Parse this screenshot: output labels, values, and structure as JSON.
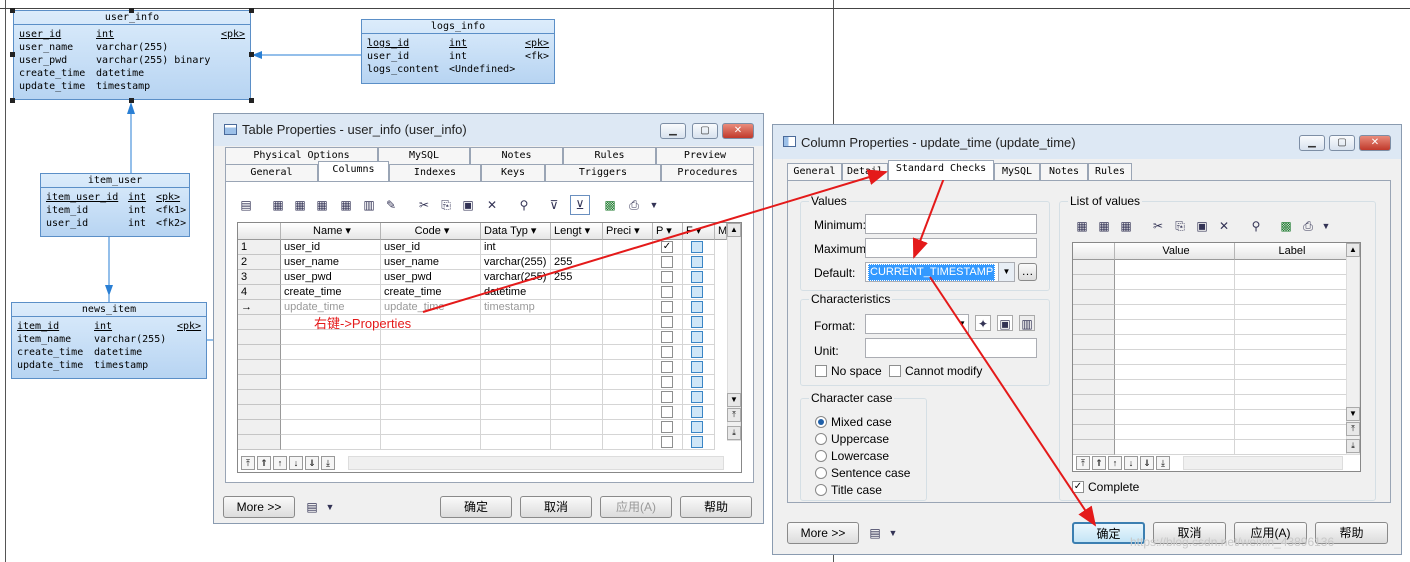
{
  "er_tables": {
    "user_info": {
      "title": "user_info",
      "rows": [
        {
          "name": "user_id",
          "type": "int",
          "key": "<pk>"
        },
        {
          "name": "user_name",
          "type": "varchar(255)",
          "key": ""
        },
        {
          "name": "user_pwd",
          "type": "varchar(255) binary",
          "key": ""
        },
        {
          "name": "create_time",
          "type": "datetime",
          "key": ""
        },
        {
          "name": "update_time",
          "type": "timestamp",
          "key": ""
        }
      ]
    },
    "logs_info": {
      "title": "logs_info",
      "rows": [
        {
          "name": "logs_id",
          "type": "int",
          "key": "<pk>"
        },
        {
          "name": "user_id",
          "type": "int",
          "key": "<fk>"
        },
        {
          "name": "logs_content",
          "type": "<Undefined>",
          "key": ""
        }
      ]
    },
    "item_user": {
      "title": "item_user",
      "rows": [
        {
          "name": "item_user_id",
          "type": "int",
          "key": "<pk>"
        },
        {
          "name": "item_id",
          "type": "int",
          "key": "<fk1>"
        },
        {
          "name": "user_id",
          "type": "int",
          "key": "<fk2>"
        }
      ]
    },
    "news_item": {
      "title": "news_item",
      "rows": [
        {
          "name": "item_id",
          "type": "int",
          "key": "<pk>"
        },
        {
          "name": "item_name",
          "type": "varchar(255)",
          "key": ""
        },
        {
          "name": "create_time",
          "type": "datetime",
          "key": ""
        },
        {
          "name": "update_time",
          "type": "timestamp",
          "key": ""
        }
      ]
    }
  },
  "table_props": {
    "title": "Table Properties - user_info (user_info)",
    "tabs_row1": [
      "Physical Options",
      "MySQL",
      "Notes",
      "Rules",
      "Preview"
    ],
    "tabs_row2": [
      "General",
      "Columns",
      "Indexes",
      "Keys",
      "Triggers",
      "Procedures"
    ],
    "active_tab": "Columns",
    "columns": [
      "Name",
      "Code",
      "Data Typ",
      "Lengt",
      "Preci",
      "P",
      "F",
      "M"
    ],
    "rows": [
      {
        "num": "1",
        "name": "user_id",
        "code": "user_id",
        "type": "int",
        "length": "",
        "pk": true
      },
      {
        "num": "2",
        "name": "user_name",
        "code": "user_name",
        "type": "varchar(255)",
        "length": "255",
        "pk": false
      },
      {
        "num": "3",
        "name": "user_pwd",
        "code": "user_pwd",
        "type": "varchar(255)",
        "length": "255",
        "pk": false
      },
      {
        "num": "4",
        "name": "create_time",
        "code": "create_time",
        "type": "datetime",
        "length": "",
        "pk": false
      },
      {
        "num": "→",
        "name": "update_time",
        "code": "update_time",
        "type": "timestamp",
        "length": "",
        "pk": false
      }
    ],
    "annotation": "右键->Properties",
    "more": "More >>",
    "ok": "确定",
    "cancel": "取消",
    "apply": "应用(A)",
    "help": "帮助"
  },
  "col_props": {
    "title": "Column Properties - update_time (update_time)",
    "tabs": [
      "General",
      "Detail",
      "Standard Checks",
      "MySQL",
      "Notes",
      "Rules"
    ],
    "active_tab": "Standard Checks",
    "values_label": "Values",
    "minimum": "Minimum:",
    "maximum": "Maximum:",
    "default": "Default:",
    "default_value": "CURRENT_TIMESTAMP",
    "characteristics": "Characteristics",
    "format": "Format:",
    "unit": "Unit:",
    "no_space": "No space",
    "cannot_modify": "Cannot modify",
    "char_case": "Character case",
    "cases": [
      "Mixed case",
      "Uppercase",
      "Lowercase",
      "Sentence case",
      "Title case"
    ],
    "selected_case": "Mixed case",
    "list_of_values": "List of values",
    "lv_columns": [
      "Value",
      "Label"
    ],
    "complete": "Complete",
    "more": "More >>",
    "ok": "确定",
    "cancel": "取消",
    "apply": "应用(A)",
    "help": "帮助"
  },
  "watermark": "https://blog.csdn.net/weixin_43896136",
  "colors": {
    "arrow": "#e41a1a",
    "connector": "#2a7fd4",
    "selection": "#3399ff"
  }
}
